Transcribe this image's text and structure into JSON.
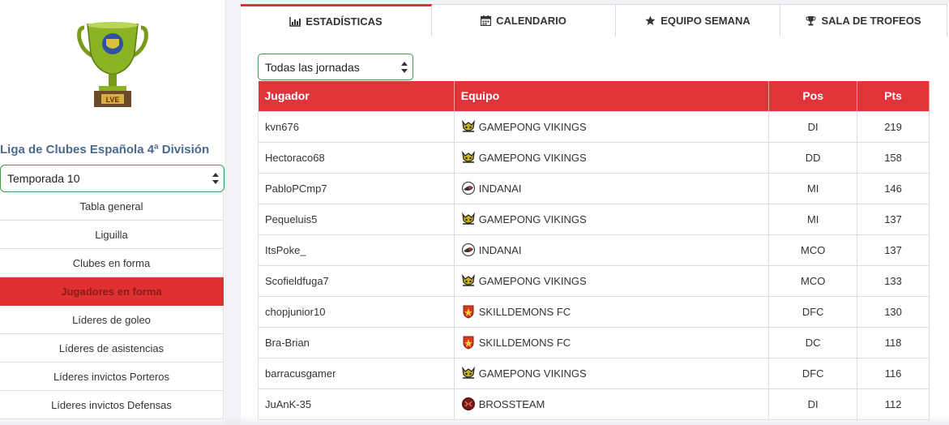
{
  "sidebar": {
    "trophy_caption": "LVE",
    "league_title": "Liga de Clubes Española 4ª División",
    "season_select": "Temporada 10",
    "menu": [
      {
        "label": "Tabla general"
      },
      {
        "label": "Liguilla"
      },
      {
        "label": "Clubes en forma"
      },
      {
        "label": "Jugadores en forma",
        "active": true
      },
      {
        "label": "Líderes de goleo"
      },
      {
        "label": "Líderes de asistencias"
      },
      {
        "label": "Líderes invictos Porteros"
      },
      {
        "label": "Líderes invictos Defensas"
      }
    ]
  },
  "tabs": [
    {
      "label": "ESTADÍSTICAS",
      "icon": "bar-chart-icon",
      "active": true
    },
    {
      "label": "CALENDARIO",
      "icon": "calendar-icon"
    },
    {
      "label": "EQUIPO SEMANA",
      "icon": "star-icon"
    },
    {
      "label": "SALA DE TROFEOS",
      "icon": "trophy-icon"
    }
  ],
  "jornada_select": "Todas las jornadas",
  "table": {
    "headers": {
      "player": "Jugador",
      "team": "Equipo",
      "pos": "Pos",
      "pts": "Pts"
    },
    "rows": [
      {
        "player": "kvn676",
        "team": "GAMEPONG VIKINGS",
        "pos": "DI",
        "pts": "219"
      },
      {
        "player": "Hectoraco68",
        "team": "GAMEPONG VIKINGS",
        "pos": "DD",
        "pts": "158"
      },
      {
        "player": "PabloPCmp7",
        "team": "INDANAI",
        "pos": "MI",
        "pts": "146"
      },
      {
        "player": "Pequeluis5",
        "team": "GAMEPONG VIKINGS",
        "pos": "MI",
        "pts": "137"
      },
      {
        "player": "ItsPoke_",
        "team": "INDANAI",
        "pos": "MCO",
        "pts": "137"
      },
      {
        "player": "Scofieldfuga7",
        "team": "GAMEPONG VIKINGS",
        "pos": "MCO",
        "pts": "133"
      },
      {
        "player": "chopjunior10",
        "team": "SKILLDEMONS FC",
        "pos": "DFC",
        "pts": "130"
      },
      {
        "player": "Bra-Brian",
        "team": "SKILLDEMONS FC",
        "pos": "DC",
        "pts": "118"
      },
      {
        "player": "barracusgamer",
        "team": "GAMEPONG VIKINGS",
        "pos": "DFC",
        "pts": "116"
      },
      {
        "player": "JuAnK-35",
        "team": "BROSSTEAM",
        "pos": "DI",
        "pts": "112"
      }
    ]
  },
  "colors": {
    "accent": "#e0343a",
    "select_border": "#3a9a4a",
    "title": "#4a6a8f"
  }
}
